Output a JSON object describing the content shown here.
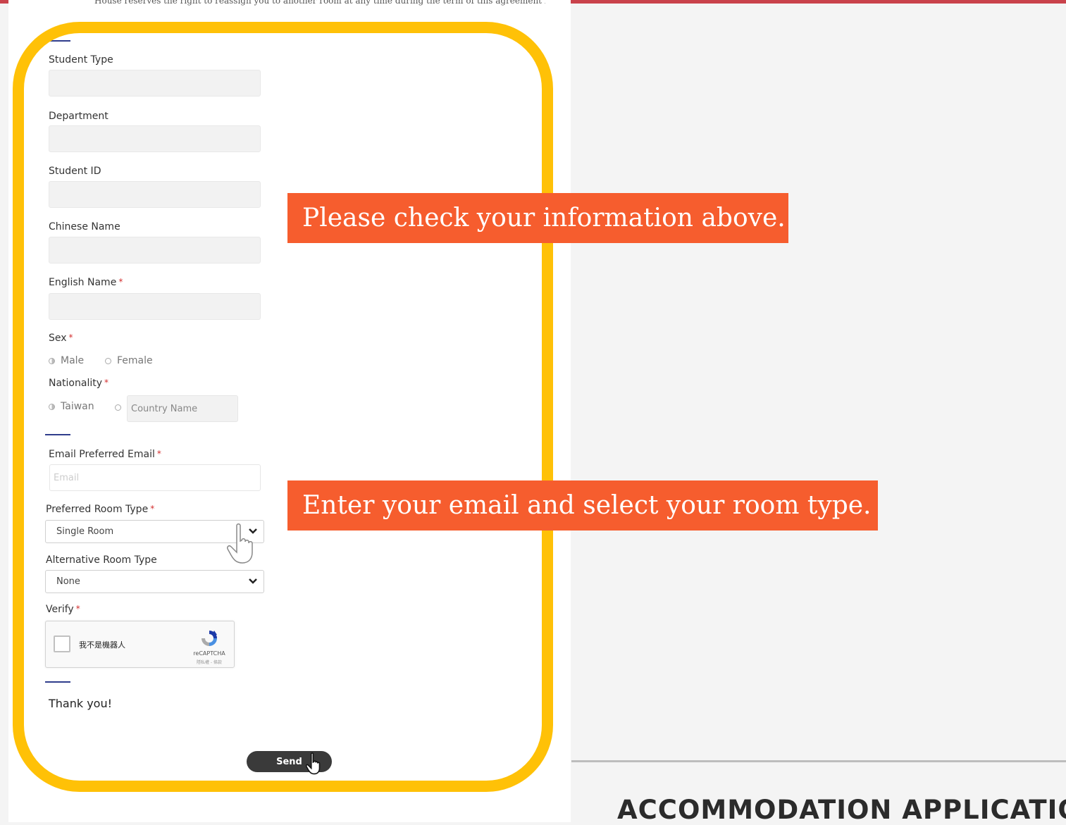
{
  "top_clipped_text": "House reserves the right to reassign you to another room at any time during the term of this agreement for",
  "form": {
    "student_type": {
      "label": "Student Type"
    },
    "department": {
      "label": "Department"
    },
    "student_id": {
      "label": "Student ID"
    },
    "chinese_name": {
      "label": "Chinese Name"
    },
    "english_name": {
      "label": "English Name",
      "required": "*"
    },
    "sex": {
      "label": "Sex",
      "required": "*",
      "options": [
        "Male",
        "Female"
      ]
    },
    "nationality": {
      "label": "Nationality",
      "required": "*",
      "option_taiwan": "Taiwan",
      "country_placeholder": "Country Name"
    },
    "email": {
      "label": "Email Preferred Email",
      "required": "*",
      "placeholder": "Email"
    },
    "preferred_room": {
      "label": "Preferred Room Type",
      "required": "*",
      "value": "Single Room"
    },
    "alternative_room": {
      "label": "Alternative Room Type",
      "value": "None"
    },
    "verify": {
      "label": "Verify",
      "required": "*"
    },
    "captcha": {
      "text": "我不是機器人",
      "brand": "reCAPTCHA",
      "terms": "隱私權 - 條款"
    },
    "thanks": "Thank you!",
    "send_label": "Send"
  },
  "callouts": {
    "first": "Please check your information above.",
    "second": "Enter your email and select your room type."
  },
  "page_heading": "ACCOMMODATION APPLICATIO",
  "colors": {
    "highlight_frame": "#ffc107",
    "callout_bg": "#f65d2e",
    "top_bar": "#c9424b"
  }
}
